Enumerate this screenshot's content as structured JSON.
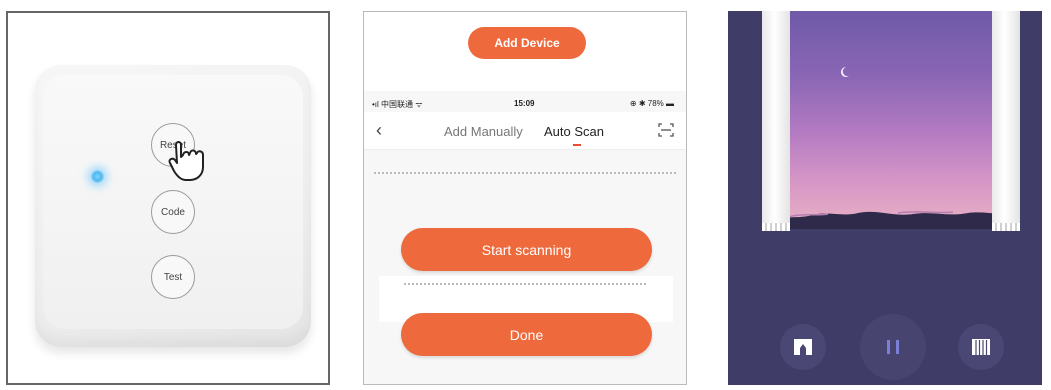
{
  "device_panel": {
    "buttons": [
      {
        "label": "Reset"
      },
      {
        "label": "Code"
      },
      {
        "label": "Test"
      }
    ]
  },
  "app_panel": {
    "add_device_label": "Add Device",
    "status_bar": {
      "carrier": "•ıl 中国联通 ᯤ",
      "time": "15:09",
      "right": "⊕ ✱ 78% ▬"
    },
    "nav": {
      "back_icon": "chevron-left-icon",
      "tabs": [
        {
          "label": "Add Manually",
          "active": false
        },
        {
          "label": "Auto Scan",
          "active": true
        }
      ],
      "scan_icon": "scan-frame-icon"
    },
    "start_scanning_label": "Start scanning",
    "done_label": "Done",
    "accent_color": "#ee6a3d"
  },
  "curtain_panel": {
    "background_color": "#3f3c68",
    "controls": [
      {
        "icon": "curtain-open-icon"
      },
      {
        "icon": "pause-icon"
      },
      {
        "icon": "curtain-close-icon"
      }
    ]
  }
}
